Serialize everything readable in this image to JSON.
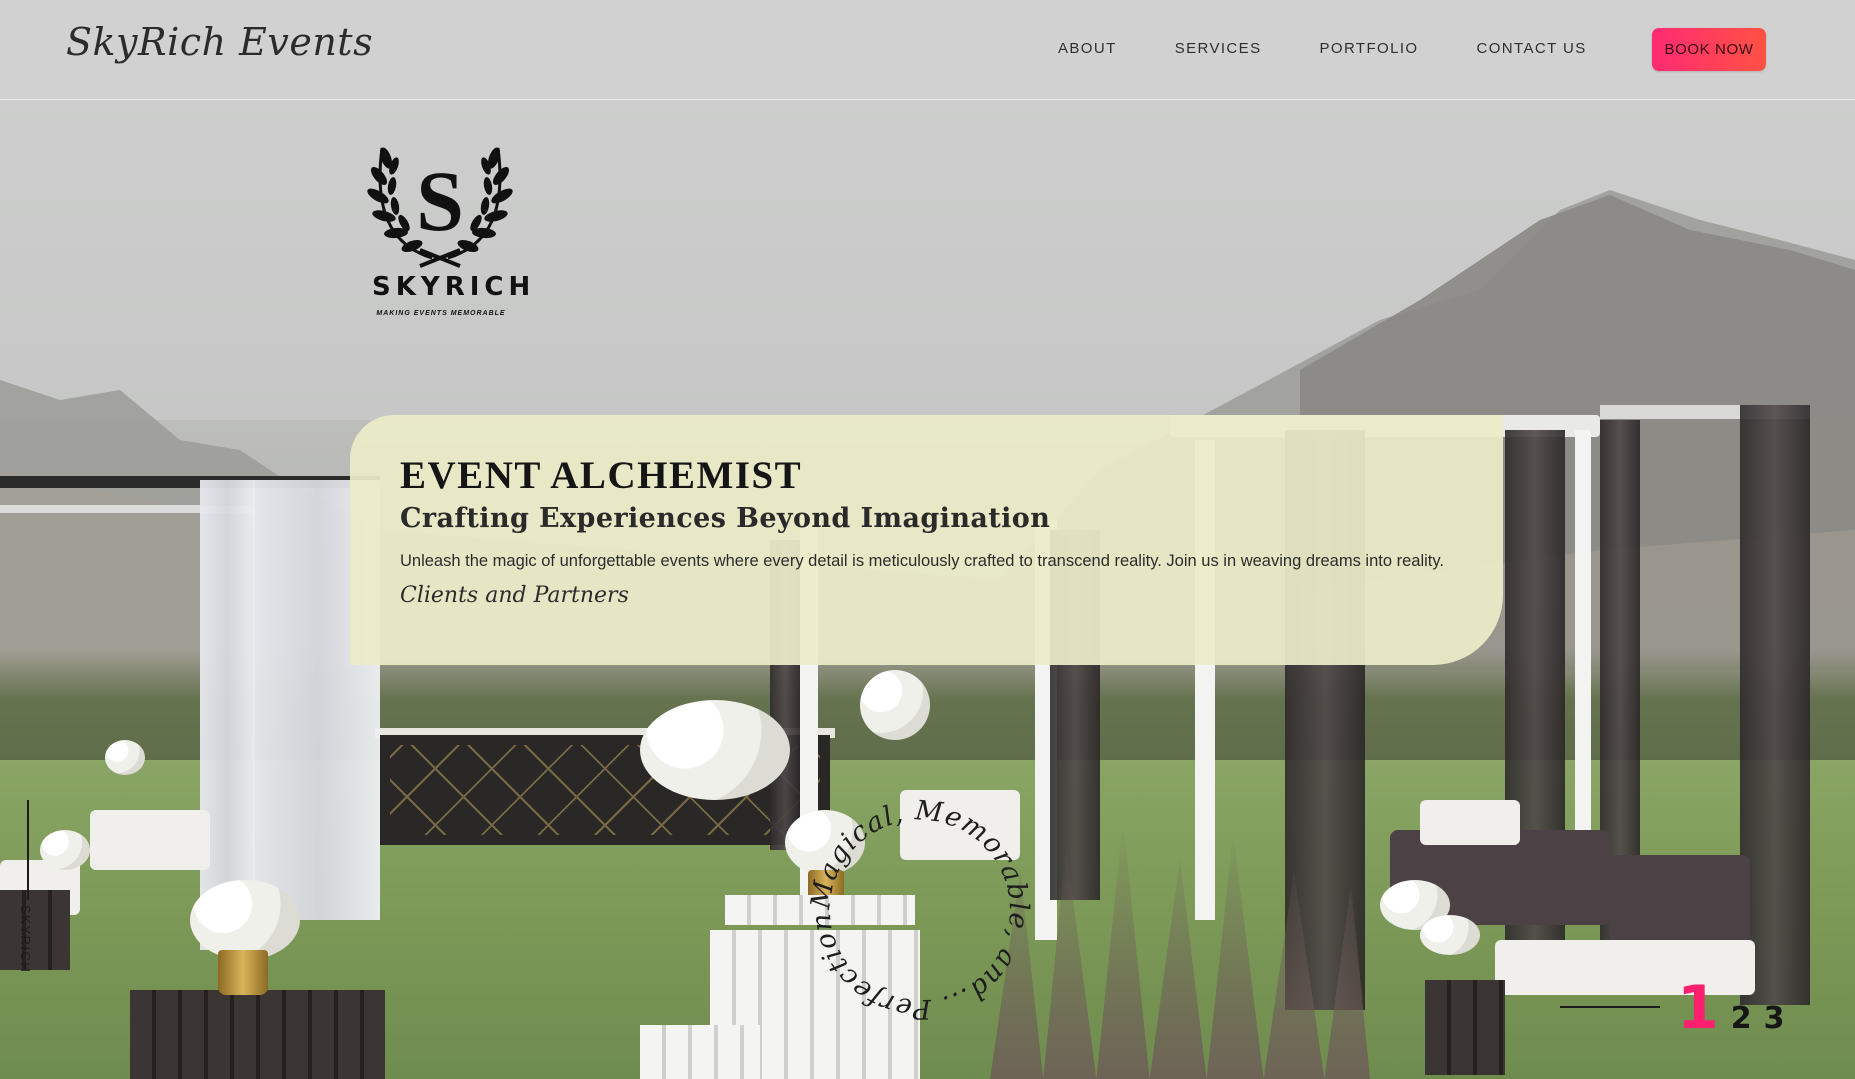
{
  "brand": {
    "name": "SkyRich Events"
  },
  "nav": {
    "items": [
      {
        "label": "ABOUT"
      },
      {
        "label": "SERVICES"
      },
      {
        "label": "PORTFOLIO"
      },
      {
        "label": "CONTACT US"
      }
    ],
    "cta_label": "BOOK NOW"
  },
  "logo": {
    "wordmark": "SKYRICH",
    "tagline": "MAKING EVENTS MEMORABLE",
    "monogram": "S"
  },
  "hero": {
    "title": "EVENT ALCHEMIST",
    "subtitle": "Crafting Experiences Beyond Imagination",
    "description": "Unleash the magic of unforgettable events where every detail is meticulously crafted to transcend reality. Join us in weaving dreams into reality.",
    "link_label": "Clients and Partners"
  },
  "side_label": "SKYRICH",
  "circular_tagline": "Magical, Memorable, and... Perfection",
  "pager": {
    "pages": [
      "1",
      "2",
      "3"
    ],
    "active": "1"
  },
  "colors": {
    "accent": "#ff1f6f",
    "cta_gradient_start": "#ff2b74",
    "cta_gradient_end": "#ff5143",
    "card": "#ececc8"
  },
  "icons": {
    "logo_emblem": "laurel-wreath-icon"
  }
}
